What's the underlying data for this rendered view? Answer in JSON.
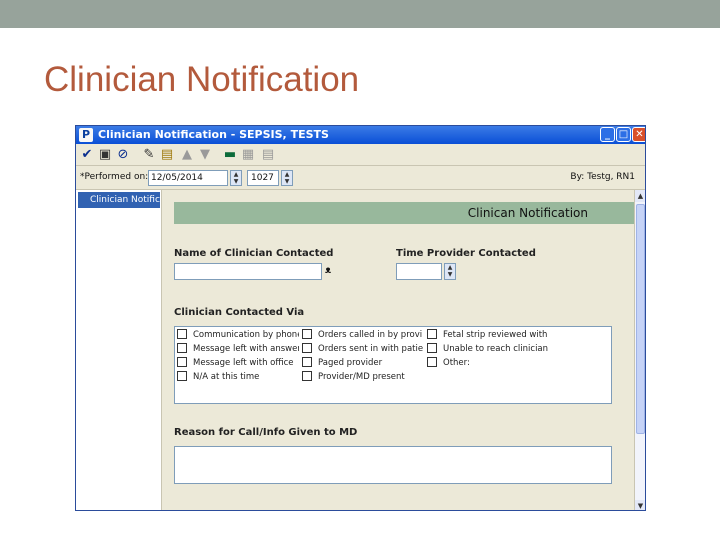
{
  "slide": {
    "title": "Clinician Notification"
  },
  "window": {
    "title": "Clinician Notification - SEPSIS, TESTS",
    "app_icon": "P",
    "controls": {
      "minimize": "_",
      "maximize": "□",
      "close": "✕"
    }
  },
  "toolbar": {
    "icons": [
      "check-icon",
      "save-icon",
      "cancel-icon",
      "pen-icon",
      "flowsheet-icon",
      "up-arrow-icon",
      "down-arrow-icon",
      "monitor-icon",
      "grid-icon",
      "document-icon"
    ]
  },
  "performed": {
    "label": "*Performed on:",
    "date": "12/05/2014",
    "time": "1027",
    "by": "By:  Testg, RN1"
  },
  "left_pane": {
    "items": [
      {
        "label": "Clinician Notificati"
      }
    ]
  },
  "form": {
    "title": "Clinican Notification",
    "name_label": "Name of Clinician Contacted",
    "time_label": "Time Provider Contacted",
    "via_label": "Clinician Contacted Via",
    "via_options": [
      [
        "Communication by phone",
        "Message left with answeri",
        "Message left with office",
        "N/A at this time"
      ],
      [
        "Orders called in by provi",
        "Orders sent in with patie",
        "Paged provider",
        "Provider/MD present"
      ],
      [
        "Fetal strip reviewed with",
        "Unable to reach clinician",
        "Other:"
      ]
    ],
    "reason_label": "Reason for Call/Info Given to MD"
  },
  "colors": {
    "slide_title": "#b35a3c",
    "top_band": "#97a39b",
    "form_header": "#98b89c",
    "selection": "#3162b2"
  }
}
